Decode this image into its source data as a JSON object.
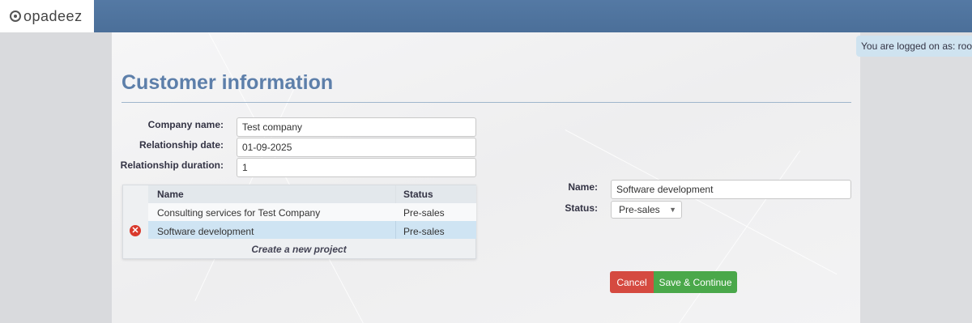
{
  "brand": {
    "name": "opadeez"
  },
  "header": {
    "logged_on": "You are logged on as: root"
  },
  "page": {
    "title": "Customer information"
  },
  "customer": {
    "company_name_label": "Company name:",
    "company_name": "Test company",
    "relationship_date_label": "Relationship date:",
    "relationship_date": "01-09-2025",
    "relationship_duration_label": "Relationship duration:",
    "relationship_duration": "1"
  },
  "projects": {
    "columns": [
      "Name",
      "Status"
    ],
    "rows": [
      {
        "name": "Consulting services for Test Company",
        "status": "Pre-sales"
      },
      {
        "name": "Software development",
        "status": "Pre-sales"
      }
    ],
    "selected_row": 1,
    "create_link": "Create a new project"
  },
  "project_detail": {
    "name_label": "Name:",
    "name": "Software development",
    "status_label": "Status:",
    "status": "Pre-sales"
  },
  "actions": {
    "cancel": "Cancel",
    "save": "Save & Continue"
  },
  "colors": {
    "header": "#4e73a0",
    "cancel": "#d54a40",
    "save": "#4aa84a",
    "title": "#5d7faa"
  }
}
